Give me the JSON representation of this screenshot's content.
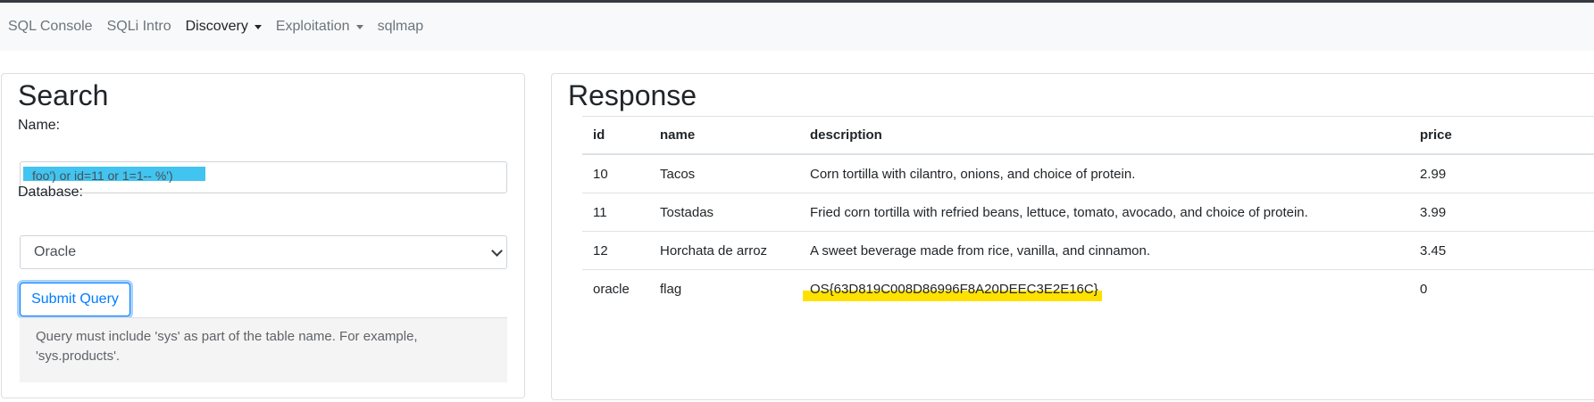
{
  "navbar": {
    "items": [
      {
        "label": "SQL Console",
        "active": false,
        "dropdown": false
      },
      {
        "label": "SQLi Intro",
        "active": false,
        "dropdown": false
      },
      {
        "label": "Discovery",
        "active": true,
        "dropdown": true
      },
      {
        "label": "Exploitation",
        "active": false,
        "dropdown": true
      },
      {
        "label": "sqlmap",
        "active": false,
        "dropdown": false
      }
    ]
  },
  "search": {
    "title": "Search",
    "name_label": "Name:",
    "name_value": "foo') or id=11 or 1=1-- %')",
    "database_label": "Database:",
    "database_value": "Oracle",
    "submit_label": "Submit Query",
    "hint": "Query must include 'sys' as part of the table name. For example, 'sys.products'."
  },
  "response": {
    "title": "Response",
    "columns": [
      "id",
      "name",
      "description",
      "price"
    ],
    "rows": [
      [
        "10",
        "Tacos",
        "Corn tortilla with cilantro, onions, and choice of protein.",
        "2.99"
      ],
      [
        "11",
        "Tostadas",
        "Fried corn tortilla with refried beans, lettuce, tomato, avocado, and choice of protein.",
        "3.99"
      ],
      [
        "12",
        "Horchata de arroz",
        "A sweet beverage made from rice, vanilla, and cinnamon.",
        "3.45"
      ],
      [
        "oracle",
        "flag",
        "OS{63D819C008D86996F8A20DEEC3E2E16C}",
        "0"
      ]
    ]
  },
  "colors": {
    "input_highlight": "#41c4f0",
    "flag_highlight": "#ffe100",
    "primary": "#007bff"
  }
}
